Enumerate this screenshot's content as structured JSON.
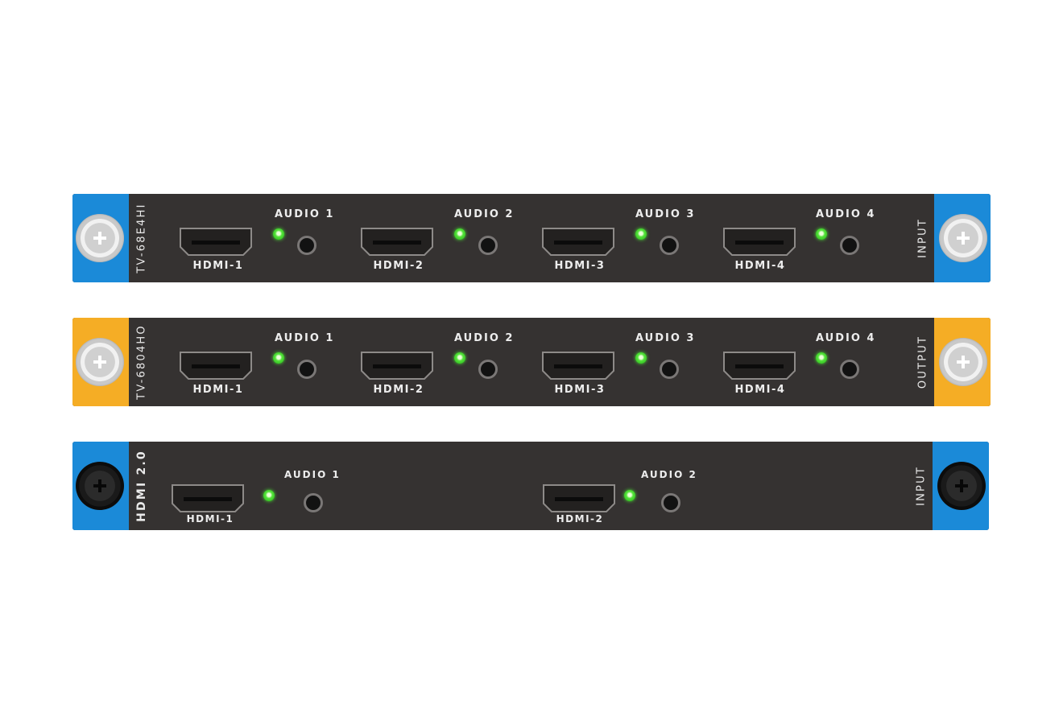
{
  "cards": [
    {
      "model": "TV-68E4HI",
      "side_label": "INPUT",
      "ear_color": "#1b8ad8",
      "screw_style": "silver",
      "hdmi_labels": [
        "HDMI-1",
        "HDMI-2",
        "HDMI-3",
        "HDMI-4"
      ],
      "audio_labels": [
        "AUDIO 1",
        "AUDIO 2",
        "AUDIO 3",
        "AUDIO 4"
      ]
    },
    {
      "model": "TV-6804HO",
      "side_label": "OUTPUT",
      "ear_color": "#f5ad25",
      "screw_style": "silver",
      "hdmi_labels": [
        "HDMI-1",
        "HDMI-2",
        "HDMI-3",
        "HDMI-4"
      ],
      "audio_labels": [
        "AUDIO 1",
        "AUDIO 2",
        "AUDIO 3",
        "AUDIO 4"
      ]
    },
    {
      "model": "HDMI 2.0",
      "side_label": "INPUT",
      "ear_color": "#1b8ad8",
      "screw_style": "black",
      "hdmi_labels": [
        "HDMI-1",
        "HDMI-2"
      ],
      "audio_labels": [
        "AUDIO 1",
        "AUDIO 2"
      ]
    }
  ],
  "led_color": "#55e23b",
  "icons": {
    "port": "hdmi-port-icon",
    "led": "led-indicator-icon",
    "jack": "audio-jack-icon",
    "screw": "thumb-screw-icon"
  }
}
